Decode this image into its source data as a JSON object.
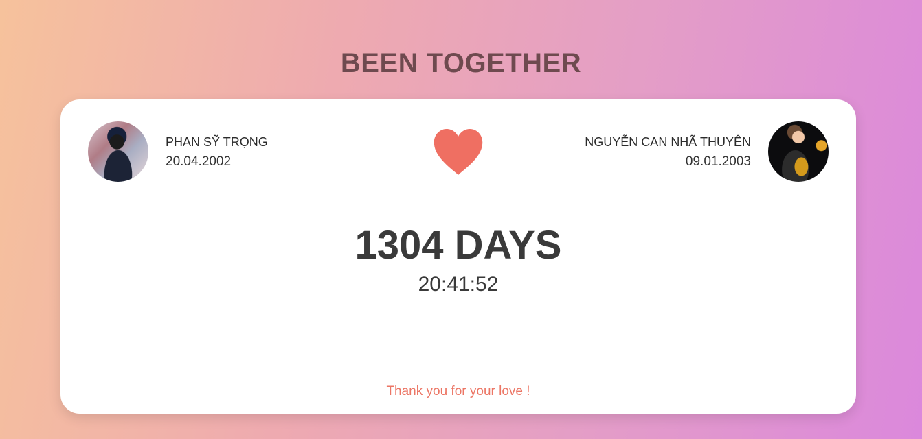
{
  "page": {
    "title": "BEEN TOGETHER"
  },
  "card": {
    "left_person": {
      "name": "PHAN SỸ TRỌNG",
      "date": "20.04.2002"
    },
    "right_person": {
      "name": "NGUYỄN CAN NHÃ THUYÊN",
      "date": "09.01.2003"
    },
    "days_label": "1304 DAYS",
    "time_label": "20:41:52",
    "thanks_text": "Thank you for your love !",
    "heart_icon": "heart-icon",
    "colors": {
      "heart": "#ef6f62",
      "title": "#6e4a4f",
      "thanks": "#ec7665"
    }
  }
}
